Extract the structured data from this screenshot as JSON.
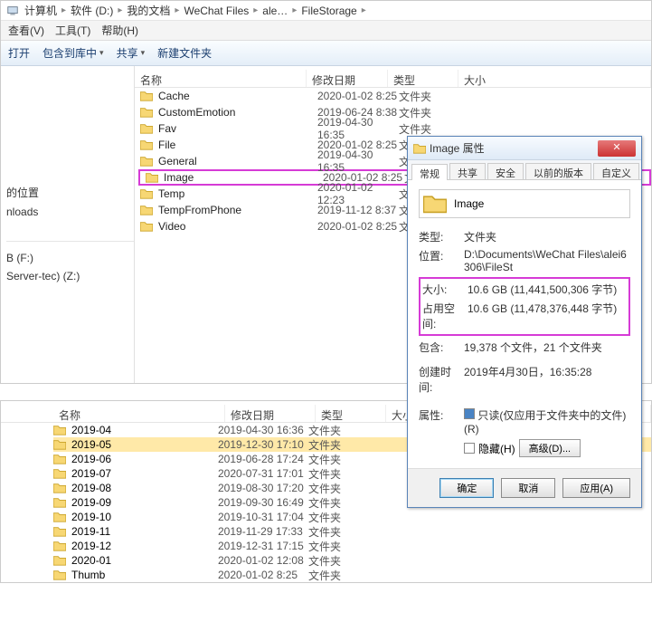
{
  "breadcrumb": [
    "计算机",
    "软件 (D:)",
    "我的文档",
    "WeChat Files",
    "ale…",
    "FileStorage"
  ],
  "menu": {
    "view": "查看(V)",
    "tools": "工具(T)",
    "help": "帮助(H)"
  },
  "toolbar": {
    "open": "打开",
    "include": "包含到库中",
    "share": "共享",
    "newfolder": "新建文件夹"
  },
  "headers": {
    "name": "名称",
    "date": "修改日期",
    "type": "类型",
    "size": "大小"
  },
  "sidebar": {
    "a": "的位置",
    "b": "nloads",
    "c": "B (F:)",
    "d": "Server-tec) (Z:)"
  },
  "folder_type": "文件夹",
  "files": [
    {
      "name": "Cache",
      "date": "2020-01-02 8:25"
    },
    {
      "name": "CustomEmotion",
      "date": "2019-06-24 8:38"
    },
    {
      "name": "Fav",
      "date": "2019-04-30 16:35"
    },
    {
      "name": "File",
      "date": "2020-01-02 8:25"
    },
    {
      "name": "General",
      "date": "2019-04-30 16:35"
    },
    {
      "name": "Image",
      "date": "2020-01-02 8:25",
      "hl": true
    },
    {
      "name": "Temp",
      "date": "2020-01-02 12:23"
    },
    {
      "name": "TempFromPhone",
      "date": "2019-11-12 8:37"
    },
    {
      "name": "Video",
      "date": "2020-01-02 8:25"
    }
  ],
  "props": {
    "title": "Image 属性",
    "tabs": {
      "general": "常规",
      "share": "共享",
      "security": "安全",
      "prev": "以前的版本",
      "custom": "自定义"
    },
    "name_value": "Image",
    "labels": {
      "type": "类型:",
      "location": "位置:",
      "size": "大小:",
      "ondisk": "占用空间:",
      "contains": "包含:",
      "created": "创建时间:",
      "attrs": "属性:"
    },
    "type_val": "文件夹",
    "location_val": "D:\\Documents\\WeChat Files\\alei6306\\FileSt",
    "size_val": "10.6 GB (11,441,500,306 字节)",
    "ondisk_val": "10.6 GB (11,478,376,448 字节)",
    "contains_val": "19,378 个文件，21 个文件夹",
    "created_val": "2019年4月30日，16:35:28",
    "readonly": "只读(仅应用于文件夹中的文件)(R)",
    "hidden": "隐藏(H)",
    "advanced": "高级(D)...",
    "ok": "确定",
    "cancel": "取消",
    "apply": "应用(A)"
  },
  "bottom_files": [
    {
      "name": "2019-04",
      "date": "2019-04-30 16:36"
    },
    {
      "name": "2019-05",
      "date": "2019-12-30 17:10",
      "sel": true
    },
    {
      "name": "2019-06",
      "date": "2019-06-28 17:24"
    },
    {
      "name": "2019-07",
      "date": "2020-07-31 17:01"
    },
    {
      "name": "2019-08",
      "date": "2019-08-30 17:20"
    },
    {
      "name": "2019-09",
      "date": "2019-09-30 16:49"
    },
    {
      "name": "2019-10",
      "date": "2019-10-31 17:04"
    },
    {
      "name": "2019-11",
      "date": "2019-11-29 17:33"
    },
    {
      "name": "2019-12",
      "date": "2019-12-31 17:15"
    },
    {
      "name": "2020-01",
      "date": "2020-01-02 12:08"
    },
    {
      "name": "Thumb",
      "date": "2020-01-02 8:25"
    }
  ]
}
